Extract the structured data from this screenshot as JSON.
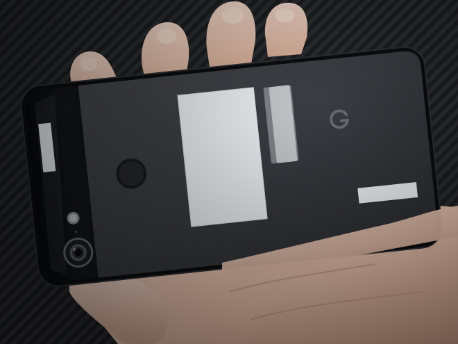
{
  "scene": {
    "subject": "phone-back-held-in-hand",
    "colors": {
      "seat_fabric_light": "#2b2c30",
      "seat_fabric_dark": "#1c1d20",
      "skin": "#e8c6b4",
      "skin_shadow": "#c89e8a",
      "phone_glass": "#0e0f12",
      "phone_matte": "#3a3b3f",
      "sticker": "#eef0f4",
      "logo": "#5a5b60"
    },
    "icons": {
      "brand_logo": "google-g-logo-icon",
      "camera": "rear-camera-lens-icon",
      "flash": "flash-icon",
      "fingerprint": "fingerprint-sensor-icon"
    }
  }
}
